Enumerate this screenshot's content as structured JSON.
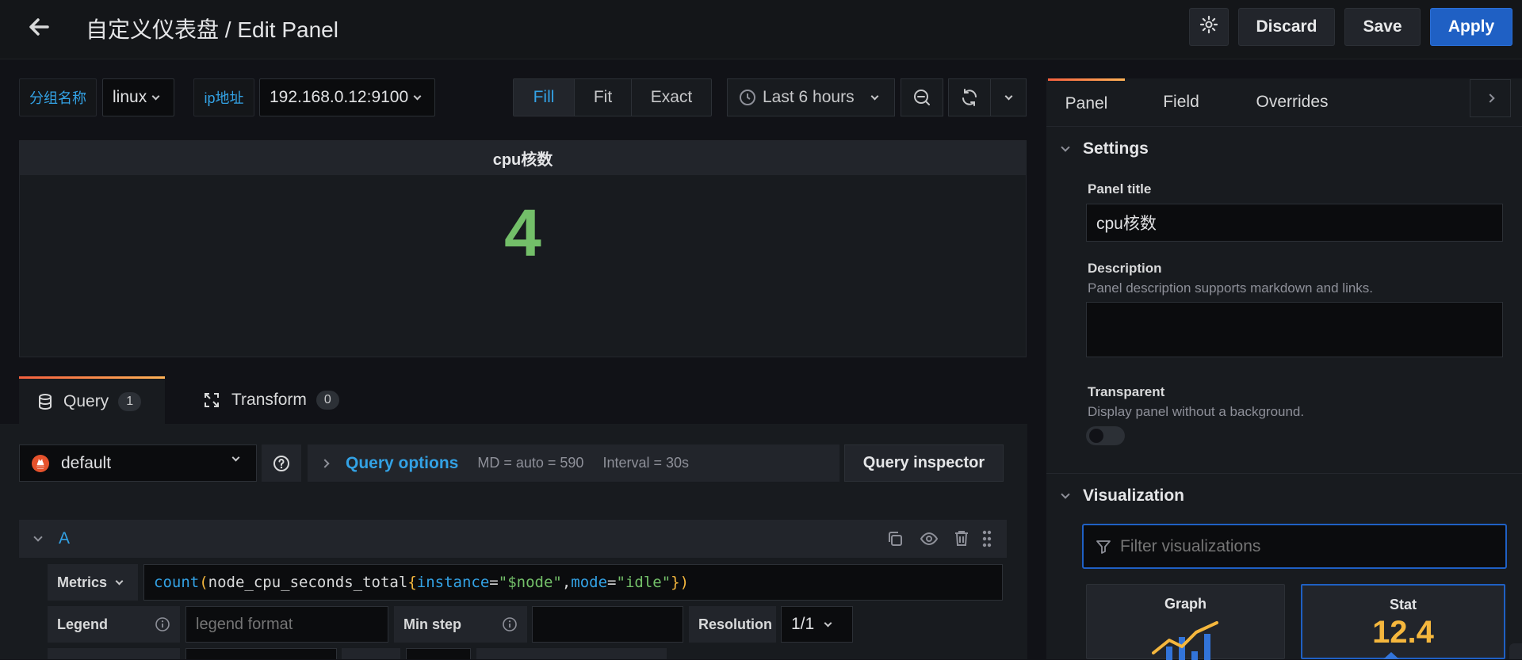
{
  "topbar": {
    "title": "自定义仪表盘 / Edit Panel",
    "discard_label": "Discard",
    "save_label": "Save",
    "apply_label": "Apply"
  },
  "variables": [
    {
      "label": "分组名称",
      "value": "linux"
    },
    {
      "label": "ip地址",
      "value": "192.168.0.12:9100"
    }
  ],
  "display_mode": {
    "options": [
      "Fill",
      "Fit",
      "Exact"
    ],
    "selected": "Fill"
  },
  "time_picker": {
    "label": "Last 6 hours"
  },
  "panel": {
    "title": "cpu核数",
    "stat_value": "4"
  },
  "editor_tabs": [
    {
      "label": "Query",
      "count": "1"
    },
    {
      "label": "Transform",
      "count": "0"
    }
  ],
  "query": {
    "datasource": "default",
    "options_label": "Query options",
    "md": "MD = auto = 590",
    "interval": "Interval = 30s",
    "inspector_label": "Query inspector",
    "ref_id": "A",
    "metrics_label": "Metrics",
    "expr": {
      "fn": "count",
      "open": "(",
      "metric": "node_cpu_seconds_total",
      "brace_open": "{",
      "k1": "instance",
      "eq": "=",
      "v1": "\"$node\"",
      "comma": ",",
      "k2": "mode",
      "v2": "\"idle\"",
      "brace_close": "}",
      "close": ")"
    },
    "legend_label": "Legend",
    "legend_placeholder": "legend format",
    "min_step_label": "Min step",
    "resolution_label": "Resolution",
    "resolution_value": "1/1"
  },
  "options_pane": {
    "tabs": [
      "Panel",
      "Field",
      "Overrides"
    ],
    "settings_title": "Settings",
    "panel_title_label": "Panel title",
    "panel_title_value": "cpu核数",
    "description_label": "Description",
    "description_hint": "Panel description supports markdown and links.",
    "transparent_label": "Transparent",
    "transparent_hint": "Display panel without a background.",
    "visualization_title": "Visualization",
    "filter_placeholder": "Filter visualizations",
    "viz_cards": [
      {
        "name": "Graph"
      },
      {
        "name": "Stat",
        "sample": "12.4"
      }
    ]
  },
  "colors": {
    "accent": "#33a2e5",
    "primary": "#1f60c4",
    "stat": "#73bf69",
    "stat_sample": "#f5b73d"
  }
}
